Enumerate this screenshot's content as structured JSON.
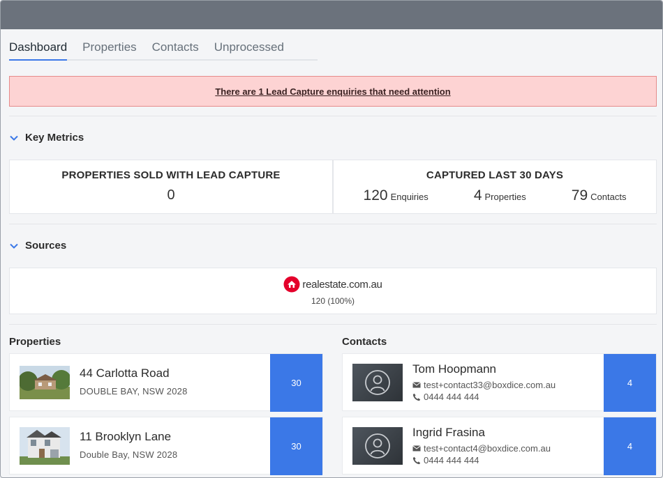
{
  "tabs": [
    {
      "label": "Dashboard",
      "active": true
    },
    {
      "label": "Properties",
      "active": false
    },
    {
      "label": "Contacts",
      "active": false
    },
    {
      "label": "Unprocessed",
      "active": false
    }
  ],
  "alert": {
    "text": "There are 1 Lead Capture enquiries that need attention"
  },
  "key_metrics": {
    "heading": "Key Metrics",
    "sold": {
      "title": "PROPERTIES SOLD WITH LEAD CAPTURE",
      "value": "0"
    },
    "captured": {
      "title": "CAPTURED LAST 30 DAYS",
      "items": [
        {
          "value": "120",
          "label": "Enquiries"
        },
        {
          "value": "4",
          "label": "Properties"
        },
        {
          "value": "79",
          "label": "Contacts"
        }
      ]
    }
  },
  "sources": {
    "heading": "Sources",
    "items": [
      {
        "name": "realestate.com.au",
        "value": "120 (100%)",
        "brand_color": "#e4002b"
      }
    ]
  },
  "properties": {
    "heading": "Properties",
    "items": [
      {
        "address": "44 Carlotta Road",
        "suburb": "DOUBLE BAY, NSW 2028",
        "count": "30"
      },
      {
        "address": "11 Brooklyn Lane",
        "suburb": "Double Bay, NSW 2028",
        "count": "30"
      }
    ]
  },
  "contacts": {
    "heading": "Contacts",
    "items": [
      {
        "name": "Tom Hoopmann",
        "email": "test+contact33@boxdice.com.au",
        "phone": "0444 444 444",
        "count": "4"
      },
      {
        "name": "Ingrid Frasina",
        "email": "test+contact4@boxdice.com.au",
        "phone": "0444 444 444",
        "count": "4"
      }
    ]
  },
  "colors": {
    "accent": "#3b78e7",
    "alert_bg": "#fdd3d3",
    "topbar": "#6b727c"
  }
}
